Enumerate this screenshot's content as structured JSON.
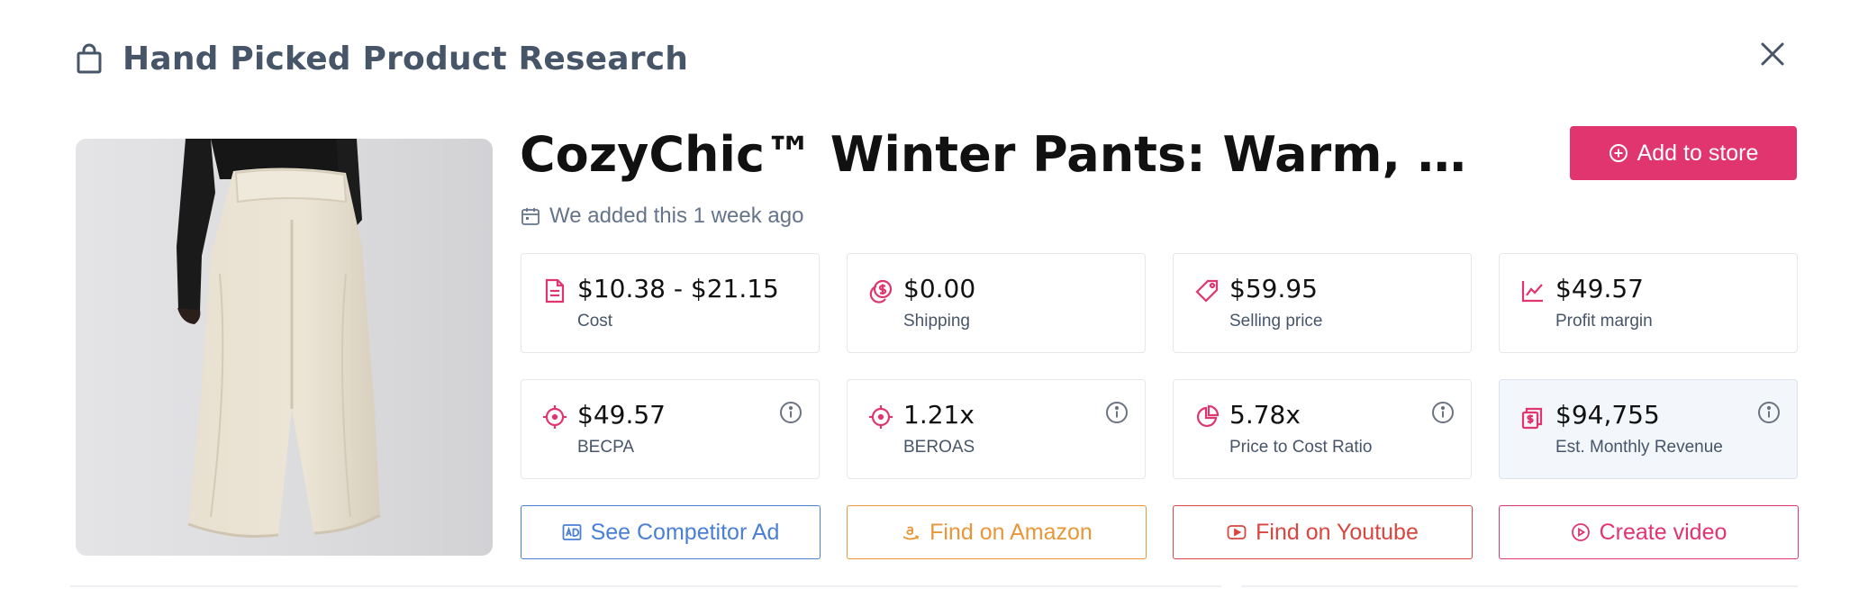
{
  "header": {
    "title": "Hand Picked Product Research",
    "icon": "shopping-bag-icon",
    "close_icon": "close-icon"
  },
  "product": {
    "title": "CozyChic™ Winter Pants: Warm, Loos…",
    "added_text": "We added this 1 week ago",
    "image_alt": "Model wearing wide cream fleece winter pants"
  },
  "add_button": {
    "label": "Add to store",
    "icon": "plus-circle-icon",
    "color": "#e0356e"
  },
  "stats": [
    {
      "value": "$10.38 - $21.15",
      "label": "Cost",
      "icon": "document-icon"
    },
    {
      "value": "$0.00",
      "label": "Shipping",
      "icon": "coins-icon"
    },
    {
      "value": "$59.95",
      "label": "Selling price",
      "icon": "price-tag-icon"
    },
    {
      "value": "$49.57",
      "label": "Profit margin",
      "icon": "line-chart-icon"
    },
    {
      "value": "$49.57",
      "label": "BECPA",
      "icon": "crosshair-icon",
      "info": true
    },
    {
      "value": "1.21x",
      "label": "BEROAS",
      "icon": "crosshair-icon",
      "info": true
    },
    {
      "value": "5.78x",
      "label": "Price to Cost Ratio",
      "icon": "pie-chart-icon",
      "info": true
    },
    {
      "value": "$94,755",
      "label": "Est. Monthly Revenue",
      "icon": "money-stack-icon",
      "info": true
    }
  ],
  "actions": [
    {
      "label": "See Competitor Ad",
      "icon": "ad-icon",
      "color": "#4a7fd6"
    },
    {
      "label": "Find on Amazon",
      "icon": "amazon-icon",
      "color": "#e8963a"
    },
    {
      "label": "Find on Youtube",
      "icon": "youtube-icon",
      "color": "#d9453f"
    },
    {
      "label": "Create video",
      "icon": "play-circle-icon",
      "color": "#e0356e"
    }
  ],
  "colors": {
    "accent": "#e0356e",
    "icon_pink": "#e0356e",
    "text_muted": "#475569"
  }
}
